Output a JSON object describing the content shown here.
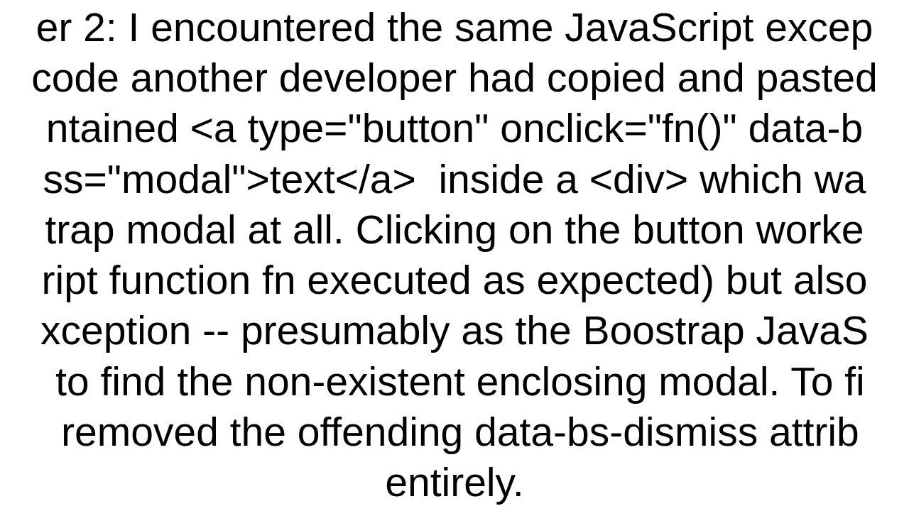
{
  "body": {
    "lines": [
      "er 2: I encountered the same JavaScript excep",
      "code another developer had copied and pasted",
      "ntained <a type=\"button\" onclick=\"fn()\" data-b",
      "ss=\"modal\">text</a>  inside a <div> which wa",
      "trap modal at all. Clicking on the button worke",
      "ript function fn executed as expected) but also",
      "xception -- presumably as the Boostrap JavaS",
      " to find the non-existent enclosing modal. To fi",
      " removed the offending data-bs-dismiss attrib",
      "entirely."
    ]
  }
}
